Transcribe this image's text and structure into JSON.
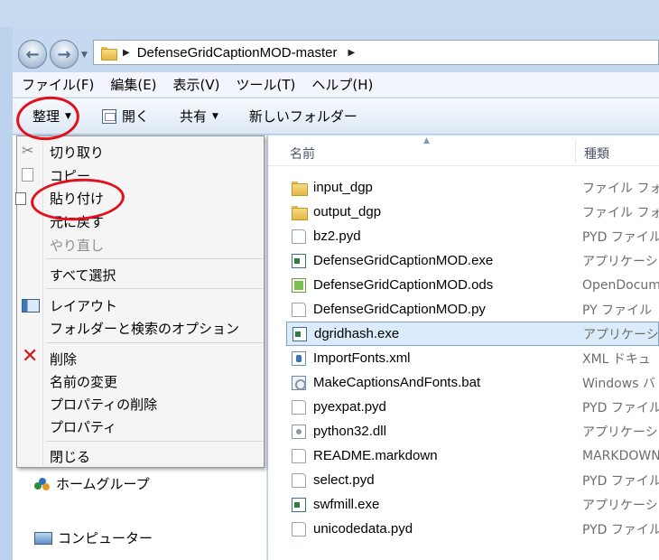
{
  "address": {
    "folder": "DefenseGridCaptionMOD-master"
  },
  "menubar": [
    "ファイル(F)",
    "編集(E)",
    "表示(V)",
    "ツール(T)",
    "ヘルプ(H)"
  ],
  "toolbar": {
    "organize": "整理",
    "open": "開く",
    "share": "共有",
    "new_folder": "新しいフォルダー"
  },
  "columns": {
    "name": "名前",
    "type": "種類"
  },
  "files": [
    {
      "name": "input_dgp",
      "type": "ファイル フォ",
      "icon": "folder-icon"
    },
    {
      "name": "output_dgp",
      "type": "ファイル フォ",
      "icon": "folder-icon"
    },
    {
      "name": "bz2.pyd",
      "type": "PYD ファイル",
      "icon": "file-icon"
    },
    {
      "name": "DefenseGridCaptionMOD.exe",
      "type": "アプリケーシ",
      "icon": "exe-icon"
    },
    {
      "name": "DefenseGridCaptionMOD.ods",
      "type": "OpenDocum",
      "icon": "spreadsheet-icon"
    },
    {
      "name": "DefenseGridCaptionMOD.py",
      "type": "PY ファイル",
      "icon": "file-icon"
    },
    {
      "name": "dgridhash.exe",
      "type": "アプリケーシ",
      "icon": "exe-icon"
    },
    {
      "name": "ImportFonts.xml",
      "type": "XML ドキュ",
      "icon": "xml-icon"
    },
    {
      "name": "MakeCaptionsAndFonts.bat",
      "type": "Windows バ",
      "icon": "batch-icon"
    },
    {
      "name": "pyexpat.pyd",
      "type": "PYD ファイル",
      "icon": "file-icon"
    },
    {
      "name": "python32.dll",
      "type": "アプリケーシ",
      "icon": "script-icon"
    },
    {
      "name": "README.markdown",
      "type": "MARKDOWN",
      "icon": "file-icon"
    },
    {
      "name": "select.pyd",
      "type": "PYD ファイル",
      "icon": "file-icon"
    },
    {
      "name": "swfmill.exe",
      "type": "アプリケーシ",
      "icon": "exe-icon"
    },
    {
      "name": "unicodedata.pyd",
      "type": "PYD ファイル",
      "icon": "file-icon"
    }
  ],
  "selected_file": "dgridhash.exe",
  "nav": {
    "homegroup": "ホームグループ",
    "computer": "コンピューター"
  },
  "context_menu": {
    "cut": "切り取り",
    "copy": "コピー",
    "paste": "貼り付け",
    "undo": "元に戻す",
    "redo": "やり直し",
    "select_all": "すべて選択",
    "layout": "レイアウト",
    "folder_options": "フォルダーと検索のオプション",
    "delete": "削除",
    "rename": "名前の変更",
    "remove_properties": "プロパティの削除",
    "properties": "プロパティ",
    "close": "閉じる"
  }
}
